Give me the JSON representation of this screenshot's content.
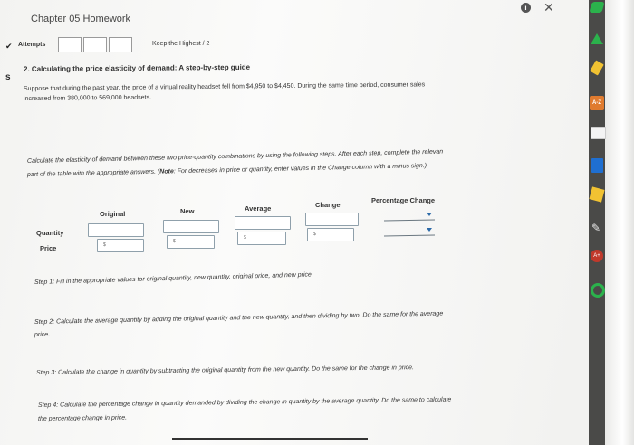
{
  "header": {
    "title": "Chapter 05 Homework",
    "attempts_label": "Attempts",
    "keep_label": "Keep the Highest / 2",
    "side_marker": "s"
  },
  "question": {
    "heading": "2. Calculating the price elasticity of demand: A step-by-step guide",
    "intro_line1": "Suppose that during the past year, the price of a virtual reality headset fell from $4,950 to $4,450. During the same time period, consumer sales",
    "intro_line2": "increased from 380,000 to 569,000 headsets.",
    "instr_line1": "Calculate the elasticity of demand between these two price-quantity combinations by using the following steps. After each step, complete the relevan",
    "instr_line2_a": "part of the table with the appropriate answers. (",
    "instr_line2_note": "Note",
    "instr_line2_b": ": For decreases in price or quantity, enter values in the Change column with a minus sign.)"
  },
  "table": {
    "headers": [
      "Original",
      "New",
      "Average",
      "Change",
      "Percentage Change"
    ],
    "rows": [
      {
        "label": "Quantity"
      },
      {
        "label": "Price",
        "prefix": "$"
      }
    ]
  },
  "steps": {
    "s1": "Step 1: Fill in the appropriate values for original quantity, new quantity, original price, and new price.",
    "s2a": "Step 2: Calculate the average quantity by adding the original quantity and the new quantity, and then dividing by two. Do the same for the average",
    "s2b": "price.",
    "s3": "Step 3: Calculate the change in quantity by subtracting the original quantity from the new quantity. Do the same for the change in price.",
    "s4a": "Step 4: Calculate the percentage change in quantity demanded by dividing the change in quantity by the average quantity. Do the same to calculate",
    "s4b": "the percentage change in price."
  },
  "rail": {
    "az_label": "A-Z"
  },
  "colors": {
    "accent": "#2c6aa8",
    "rail_green": "#2bb24c",
    "rail_blue": "#1f6fd1"
  }
}
